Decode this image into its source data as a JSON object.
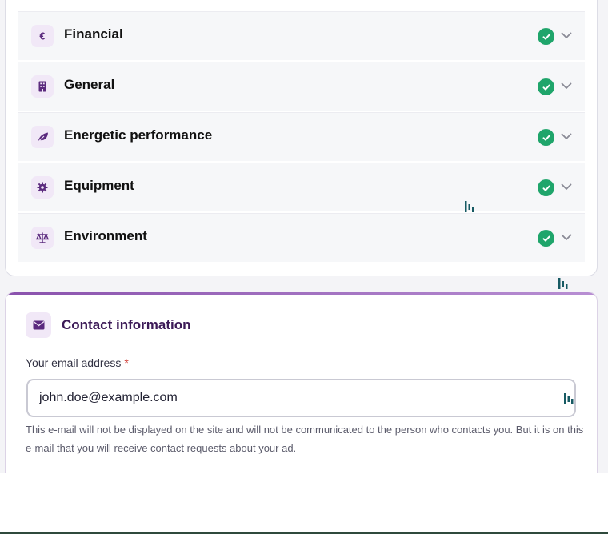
{
  "sections": [
    {
      "label": "Financial",
      "icon": "euro-icon",
      "complete": true
    },
    {
      "label": "General",
      "icon": "building-icon",
      "complete": true
    },
    {
      "label": "Energetic performance",
      "icon": "leaf-icon",
      "complete": true
    },
    {
      "label": "Equipment",
      "icon": "gear-icon",
      "complete": true
    },
    {
      "label": "Environment",
      "icon": "scales-icon",
      "complete": true
    }
  ],
  "contact": {
    "title": "Contact information",
    "icon": "envelope-icon",
    "email_label": "Your email address",
    "required_mark": "*",
    "email_value": "john.doe@example.com",
    "help_text": "This e-mail will not be displayed on the site and will not be communicated to the person who contacts you. But it is on this e-mail that you will receive contact requests about your ad."
  },
  "colors": {
    "accent": "#5b2a7e",
    "success": "#1fa56b",
    "required": "#d0413a"
  }
}
